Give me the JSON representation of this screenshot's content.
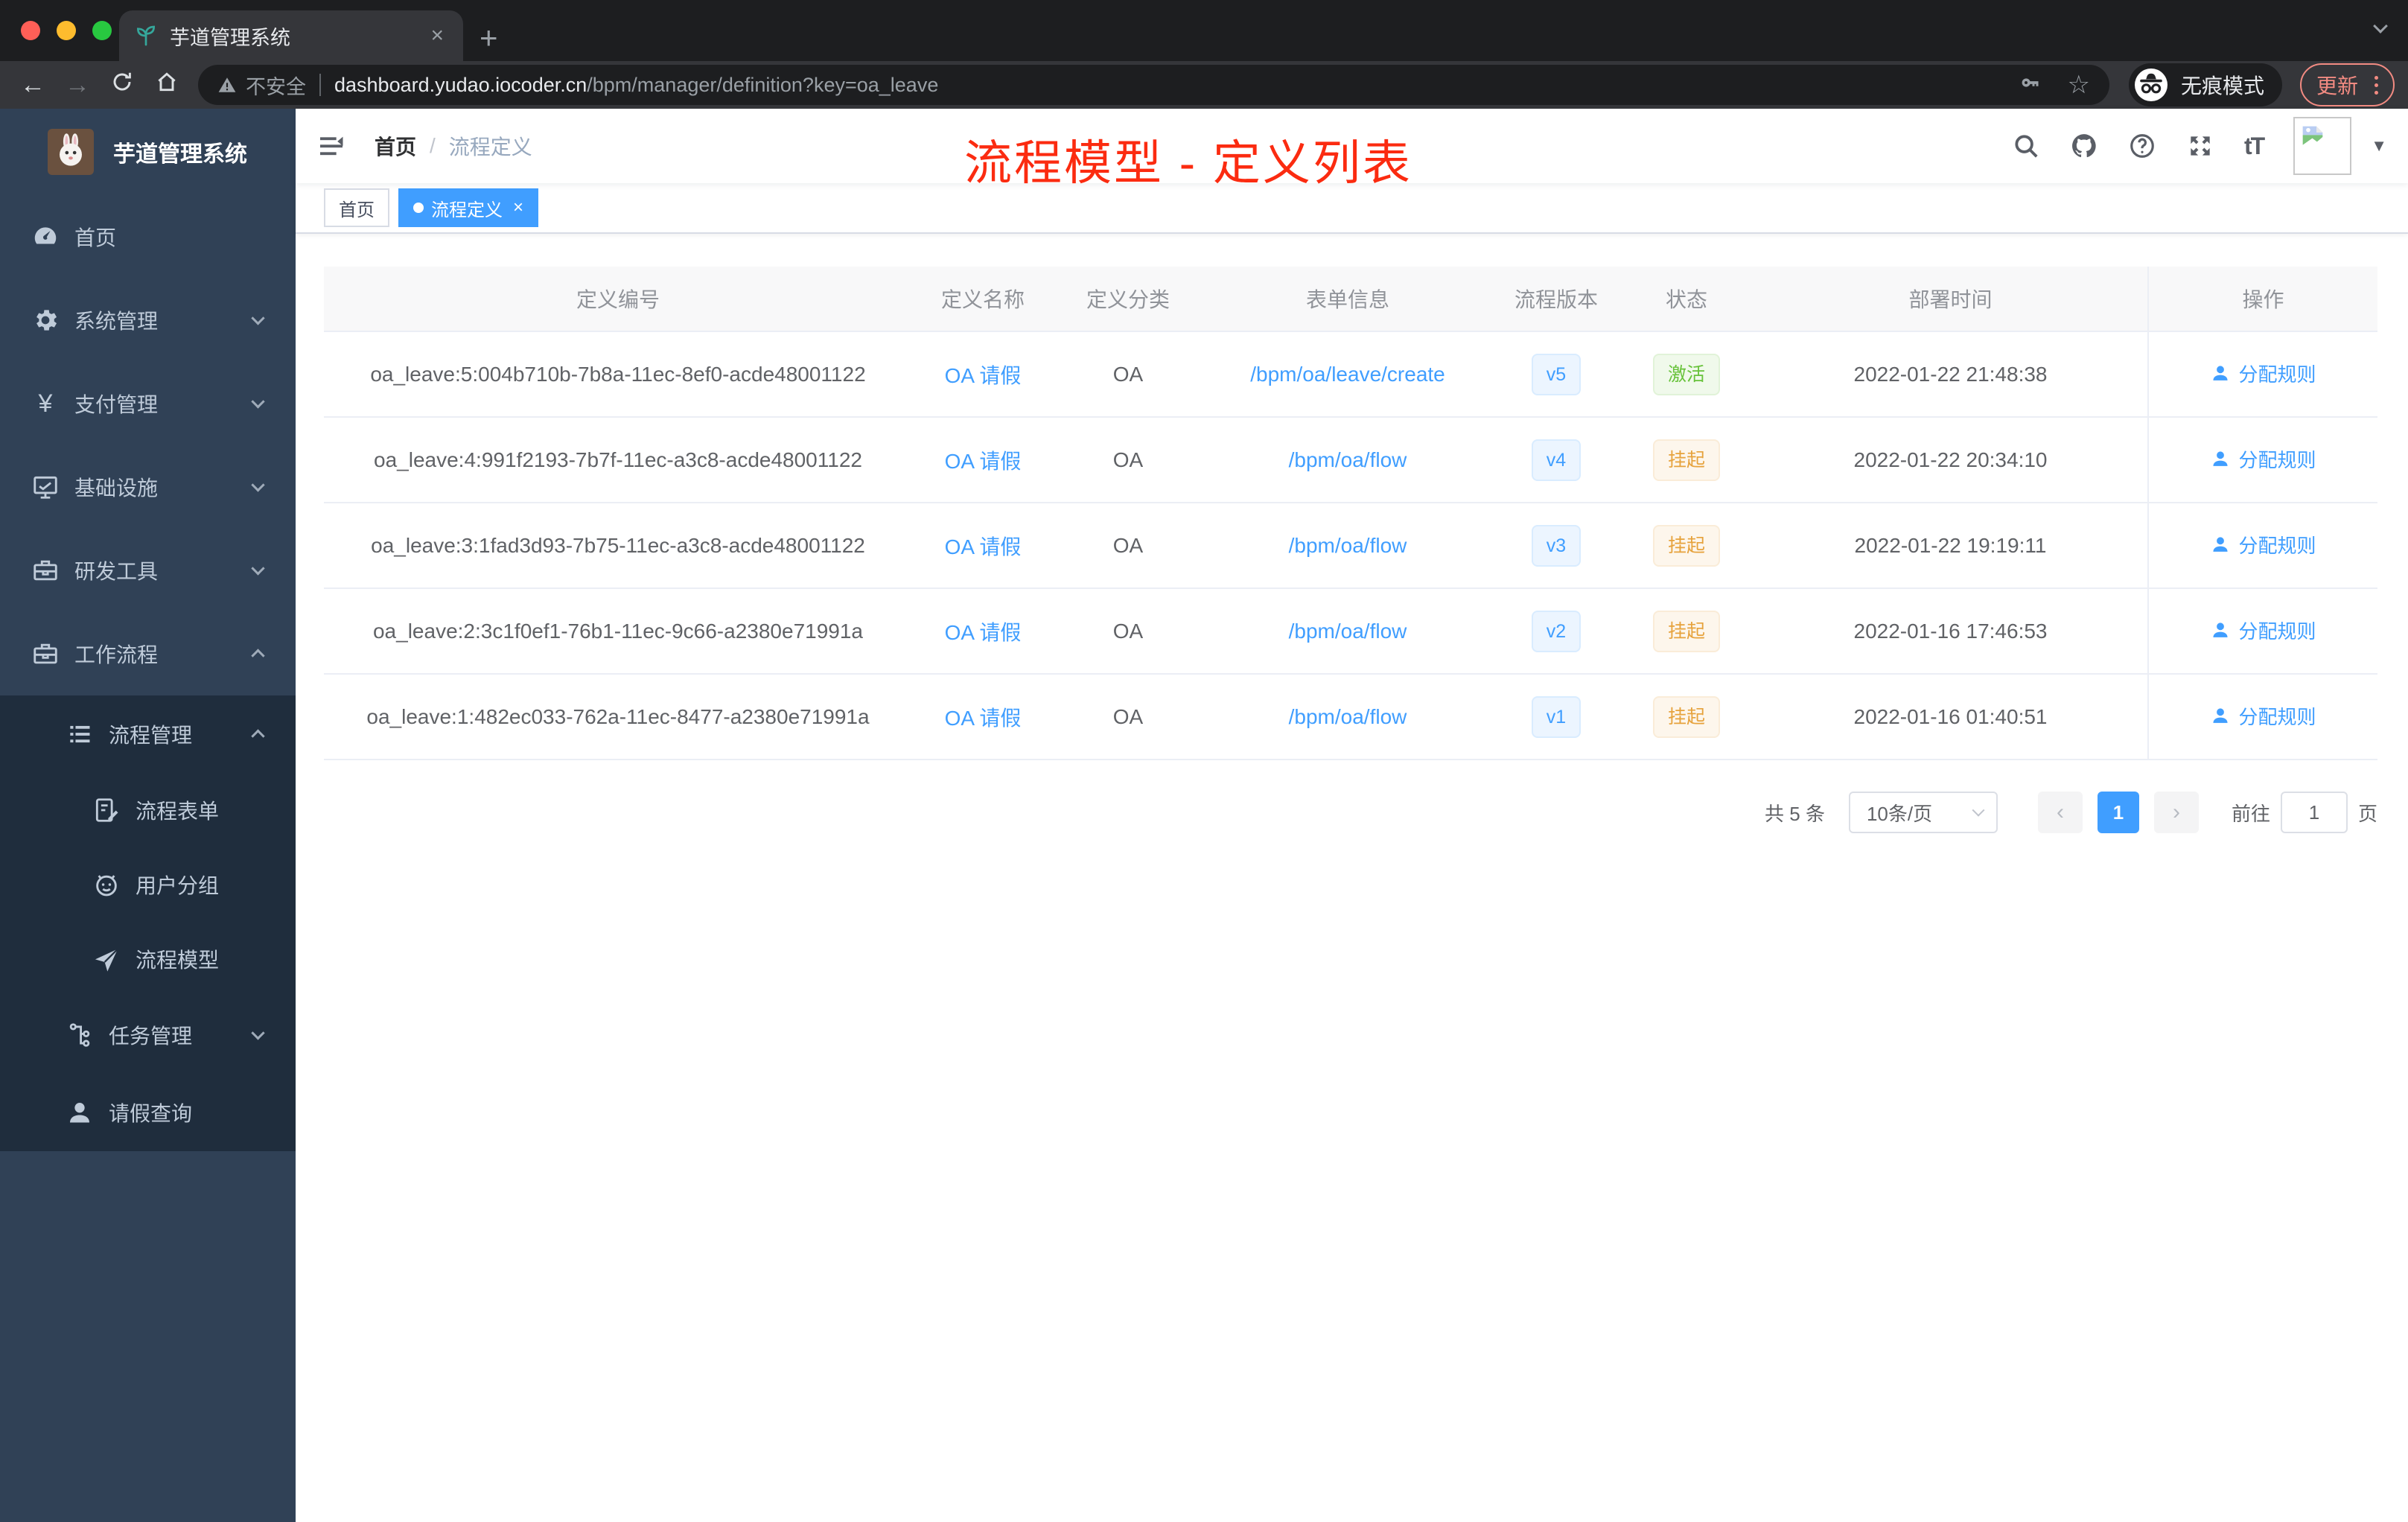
{
  "colors": {
    "accent": "#409eff",
    "annotation_red": "#fb2b10",
    "success_green": "#67c23a",
    "warning_orange": "#e6a23c",
    "sidebar_bg": "#304156",
    "sidebar_submenu_bg": "#1f2d3d",
    "update_red": "#f28b82",
    "traffic_red": "#ff5f57",
    "traffic_yellow": "#febc2e",
    "traffic_green": "#28c840"
  },
  "browser": {
    "tab_title": "芋道管理系统",
    "tab_close": "×",
    "new_tab": "+",
    "back": "←",
    "forward": "→",
    "security_label": "不安全",
    "url_host": "dashboard.yudao.iocoder.cn",
    "url_path": "/bpm/manager/definition?key=oa_leave",
    "star": "☆",
    "incognito_label": "无痕模式",
    "update_label": "更新"
  },
  "sidebar": {
    "logo_title": "芋道管理系统",
    "items": [
      {
        "id": "home",
        "label": "首页",
        "icon": "dashboard-icon",
        "level": 1,
        "arrow": "",
        "dark": false
      },
      {
        "id": "system",
        "label": "系统管理",
        "icon": "gear-icon",
        "level": 1,
        "arrow": "down",
        "dark": false
      },
      {
        "id": "payment",
        "label": "支付管理",
        "icon": "yen-icon",
        "level": 1,
        "arrow": "down",
        "dark": false
      },
      {
        "id": "infra",
        "label": "基础设施",
        "icon": "monitor-icon",
        "level": 1,
        "arrow": "down",
        "dark": false
      },
      {
        "id": "devtools",
        "label": "研发工具",
        "icon": "toolbox-icon",
        "level": 1,
        "arrow": "down",
        "dark": false
      },
      {
        "id": "workflow",
        "label": "工作流程",
        "icon": "briefcase-icon",
        "level": 1,
        "arrow": "up",
        "dark": false
      },
      {
        "id": "process-manage",
        "label": "流程管理",
        "icon": "list-icon",
        "level": 2,
        "arrow": "up",
        "dark": true
      },
      {
        "id": "process-form",
        "label": "流程表单",
        "icon": "form-icon",
        "level": 3,
        "arrow": "",
        "dark": true
      },
      {
        "id": "user-group",
        "label": "用户分组",
        "icon": "robot-icon",
        "level": 3,
        "arrow": "",
        "dark": true
      },
      {
        "id": "process-model",
        "label": "流程模型",
        "icon": "send-icon",
        "level": 3,
        "arrow": "",
        "dark": true
      },
      {
        "id": "task-manage",
        "label": "任务管理",
        "icon": "tree-icon",
        "level": 2,
        "arrow": "down",
        "dark": true
      },
      {
        "id": "leave-query",
        "label": "请假查询",
        "icon": "user-icon",
        "level": 2,
        "arrow": "",
        "dark": true
      }
    ]
  },
  "header": {
    "breadcrumb": [
      "首页",
      "流程定义"
    ],
    "breadcrumb_separator": "/",
    "annotation": "流程模型 - 定义列表"
  },
  "tags_view": {
    "tags": [
      {
        "label": "首页",
        "active": false,
        "closable": false
      },
      {
        "label": "流程定义",
        "active": true,
        "closable": true
      }
    ],
    "close_glyph": "×"
  },
  "table": {
    "columns": [
      "定义编号",
      "定义名称",
      "定义分类",
      "表单信息",
      "流程版本",
      "状态",
      "部署时间",
      "操作"
    ],
    "action_label": "分配规则",
    "rows": [
      {
        "id": "oa_leave:5:004b710b-7b8a-11ec-8ef0-acde48001122",
        "name": "OA 请假",
        "category": "OA",
        "form": "/bpm/oa/leave/create",
        "version": "v5",
        "status": "激活",
        "status_type": "success",
        "deploy_time": "2022-01-22 21:48:38"
      },
      {
        "id": "oa_leave:4:991f2193-7b7f-11ec-a3c8-acde48001122",
        "name": "OA 请假",
        "category": "OA",
        "form": "/bpm/oa/flow",
        "version": "v4",
        "status": "挂起",
        "status_type": "warning",
        "deploy_time": "2022-01-22 20:34:10"
      },
      {
        "id": "oa_leave:3:1fad3d93-7b75-11ec-a3c8-acde48001122",
        "name": "OA 请假",
        "category": "OA",
        "form": "/bpm/oa/flow",
        "version": "v3",
        "status": "挂起",
        "status_type": "warning",
        "deploy_time": "2022-01-22 19:19:11"
      },
      {
        "id": "oa_leave:2:3c1f0ef1-76b1-11ec-9c66-a2380e71991a",
        "name": "OA 请假",
        "category": "OA",
        "form": "/bpm/oa/flow",
        "version": "v2",
        "status": "挂起",
        "status_type": "warning",
        "deploy_time": "2022-01-16 17:46:53"
      },
      {
        "id": "oa_leave:1:482ec033-762a-11ec-8477-a2380e71991a",
        "name": "OA 请假",
        "category": "OA",
        "form": "/bpm/oa/flow",
        "version": "v1",
        "status": "挂起",
        "status_type": "warning",
        "deploy_time": "2022-01-16 01:40:51"
      }
    ]
  },
  "pagination": {
    "total": "共 5 条",
    "page_size": "10条/页",
    "current_page": "1",
    "goto_label": "前往",
    "goto_value": "1",
    "page_unit": "页"
  }
}
